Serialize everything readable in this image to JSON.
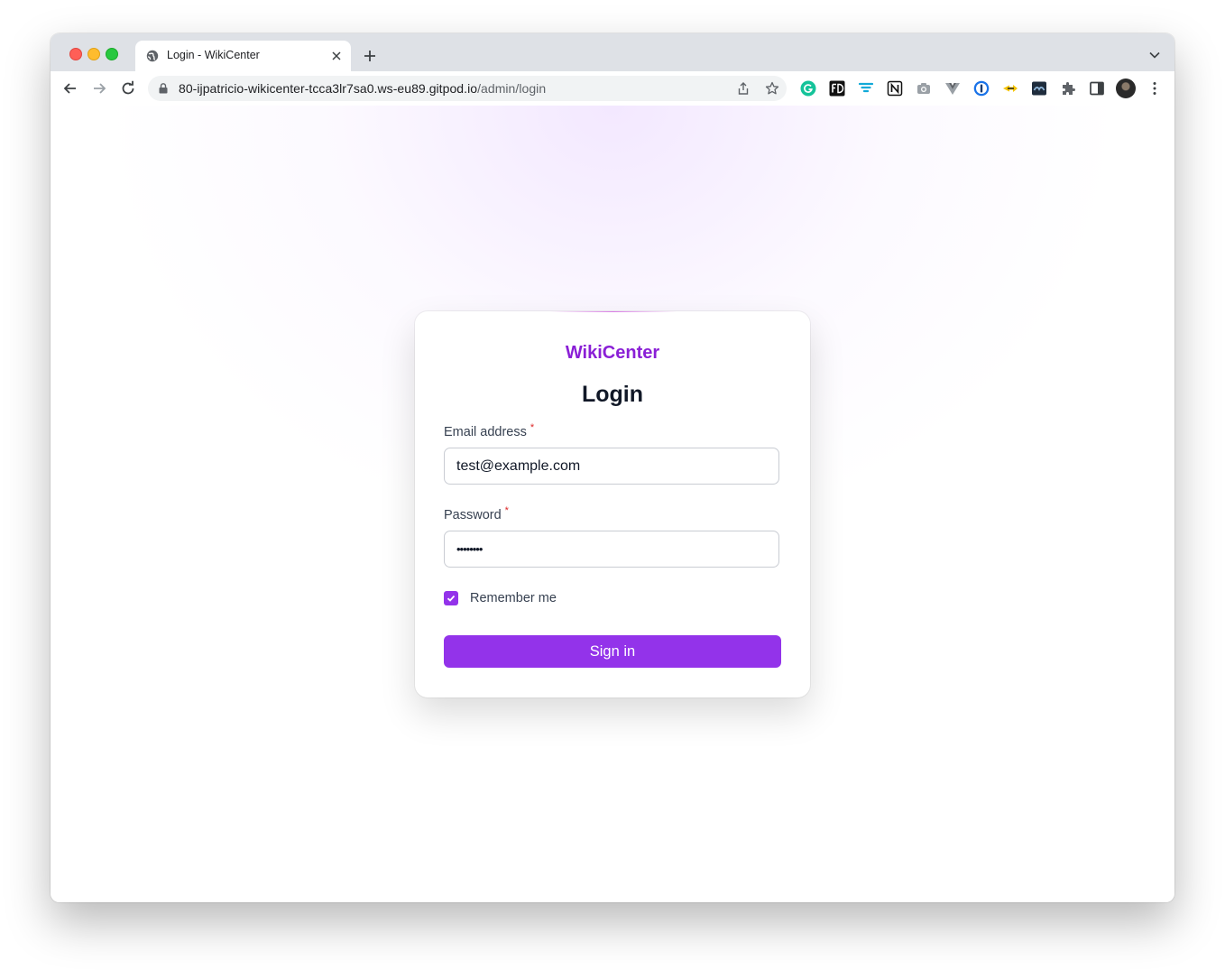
{
  "browser": {
    "tab": {
      "title": "Login - WikiCenter"
    },
    "address_bar": {
      "host": "80-ijpatricio-wikicenter-tcca3lr7sa0.ws-eu89.gitpod.io",
      "path": "/admin/login"
    },
    "extension_icons": [
      "grammarly-icon",
      "fd-icon",
      "filter-icon",
      "notion-icon",
      "camera-icon",
      "vue-devtools-icon",
      "onepassword-icon",
      "arrow-extension-icon",
      "monitor-icon",
      "puzzle-icon",
      "side-panel-icon"
    ]
  },
  "login": {
    "brand": "WikiCenter",
    "heading": "Login",
    "email": {
      "label": "Email address",
      "required_mark": "*",
      "value": "test@example.com"
    },
    "password": {
      "label": "Password",
      "required_mark": "*",
      "value": "••••••••"
    },
    "remember": {
      "label": "Remember me",
      "checked": true
    },
    "submit_label": "Sign in"
  },
  "colors": {
    "brand": "#8a1fd6",
    "primary_button": "#9333ea",
    "required": "#dc2626"
  }
}
